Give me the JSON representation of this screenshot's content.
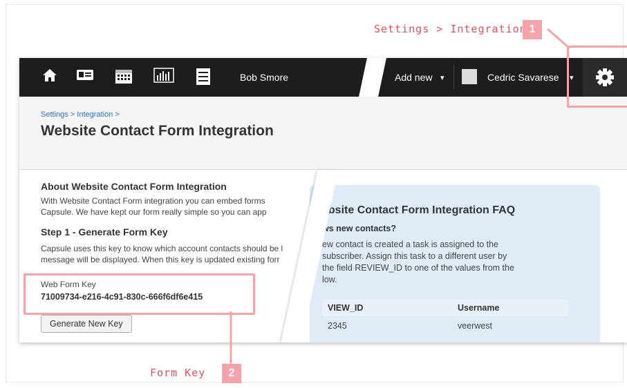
{
  "annotations": {
    "step1_label": "Settings > Integration",
    "step1_number": "1",
    "step2_label": "Form Key",
    "step2_number": "2"
  },
  "navbar": {
    "user_name": "Bob Smore",
    "add_new": "Add new",
    "current_user": "Cedric Savarese",
    "dropdown_arrow": "▾"
  },
  "header": {
    "breadcrumb": "Settings > Integration >",
    "title": "Website Contact Form Integration"
  },
  "about": {
    "heading": "About Website Contact Form Integration",
    "line1": "With Website Contact Form integration you can embed forms",
    "line2": "Capsule. We have kept our form really simple so you can app"
  },
  "step1": {
    "heading": "Step 1 - Generate Form Key",
    "line1": "Capsule uses this key to know which account contacts should be l",
    "line2": "message will be displayed. When this key is updated existing forr"
  },
  "form_key": {
    "label": "Web Form Key",
    "value": "71009734-e216-4c91-830c-666f6df6e415",
    "generate_button": "Generate New Key"
  },
  "faq": {
    "title": "ebsite Contact Form Integration FAQ",
    "question": "ws new contacts?",
    "para_line1": "ew contact is created a task is assigned to the",
    "para_line2": "subscriber. Assign this task to a different user by",
    "para_line3": "the field REVIEW_ID to one of the values from the",
    "para_line4": "low.",
    "columns": [
      "VIEW_ID",
      "Username"
    ],
    "rows": [
      [
        "2345",
        "veerwest"
      ]
    ]
  },
  "colors": {
    "accent": "#f4a3aa",
    "callout_text": "#d9535f",
    "navbar": "#1d1d1d",
    "faq_bg": "#dfecf8"
  }
}
